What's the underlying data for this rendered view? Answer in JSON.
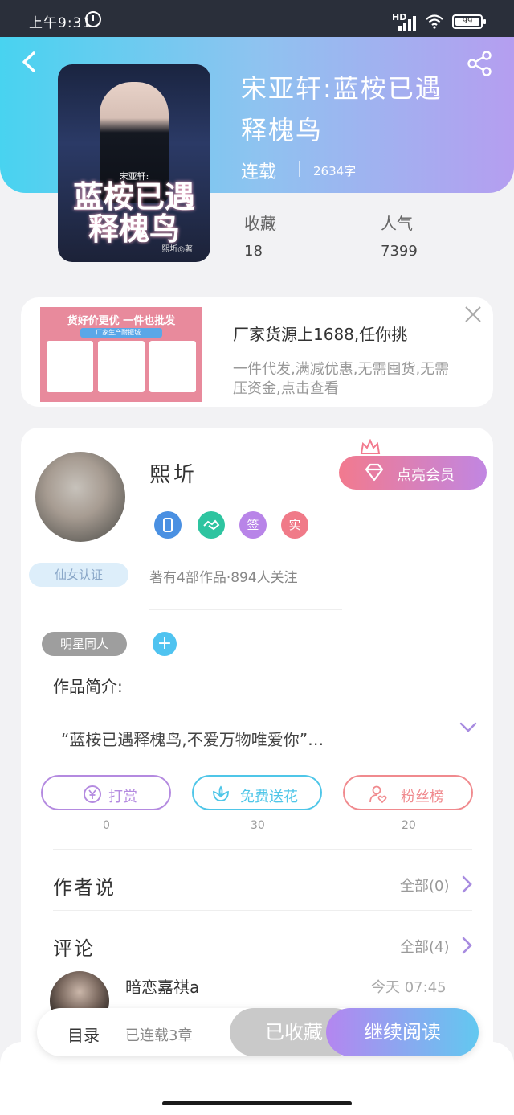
{
  "status_bar": {
    "time": "上午9:31",
    "network": "HD",
    "battery": "99"
  },
  "book": {
    "title": "宋亚轩:蓝桉已遇释槐鸟",
    "status": "连载",
    "word_count": "2634字",
    "stats": [
      {
        "label": "收藏",
        "value": "18"
      },
      {
        "label": "人气",
        "value": "7399"
      }
    ],
    "cover": {
      "subtitle": "宋亚轩:",
      "title_line1": "蓝桉已遇",
      "title_line2": "释槐鸟",
      "author": "熙圻◎著"
    }
  },
  "ad": {
    "image_headline": "货好价更优 一件也批发",
    "image_band": "厂家生产耐振城...",
    "title": "厂家货源上1688,任你挑",
    "description": "一件代发,满减优惠,无需囤货,无需压资金,点击查看"
  },
  "author": {
    "name": "熙圻",
    "badge": "仙女认证",
    "meta": "著有4部作品·894人关注",
    "honor_badges": [
      {
        "label": "",
        "color": "#4a90e2"
      },
      {
        "label": "",
        "color": "#2ec4a0"
      },
      {
        "label": "签",
        "color": "#b884e8"
      },
      {
        "label": "实",
        "color": "#f07a88"
      }
    ],
    "vip_label": "点亮会员"
  },
  "tags": [
    "明星同人"
  ],
  "synopsis": {
    "heading": "作品简介:",
    "text": "“蓝桉已遇释槐鸟,不爱万物唯爱你”…"
  },
  "actions": [
    {
      "label": "打赏",
      "count": "0",
      "color": "#b48ae0"
    },
    {
      "label": "免费送花",
      "count": "30",
      "color": "#4fc6e8"
    },
    {
      "label": "粉丝榜",
      "count": "20",
      "color": "#f08a8e"
    }
  ],
  "author_says": {
    "label": "作者说",
    "link": "全部(0)"
  },
  "comments": {
    "label": "评论",
    "link": "全部(4)",
    "first": {
      "user": "暗恋嘉祺a",
      "time": "今天 07:45"
    }
  },
  "bottom_bar": {
    "catalog": "目录",
    "progress": "已连载3章",
    "collect": "已收藏",
    "read": "继续阅读"
  },
  "colors": {
    "accent_purple": "#b486f0",
    "accent_cyan": "#48d3f0",
    "vip_pink": "#f27a8e"
  }
}
